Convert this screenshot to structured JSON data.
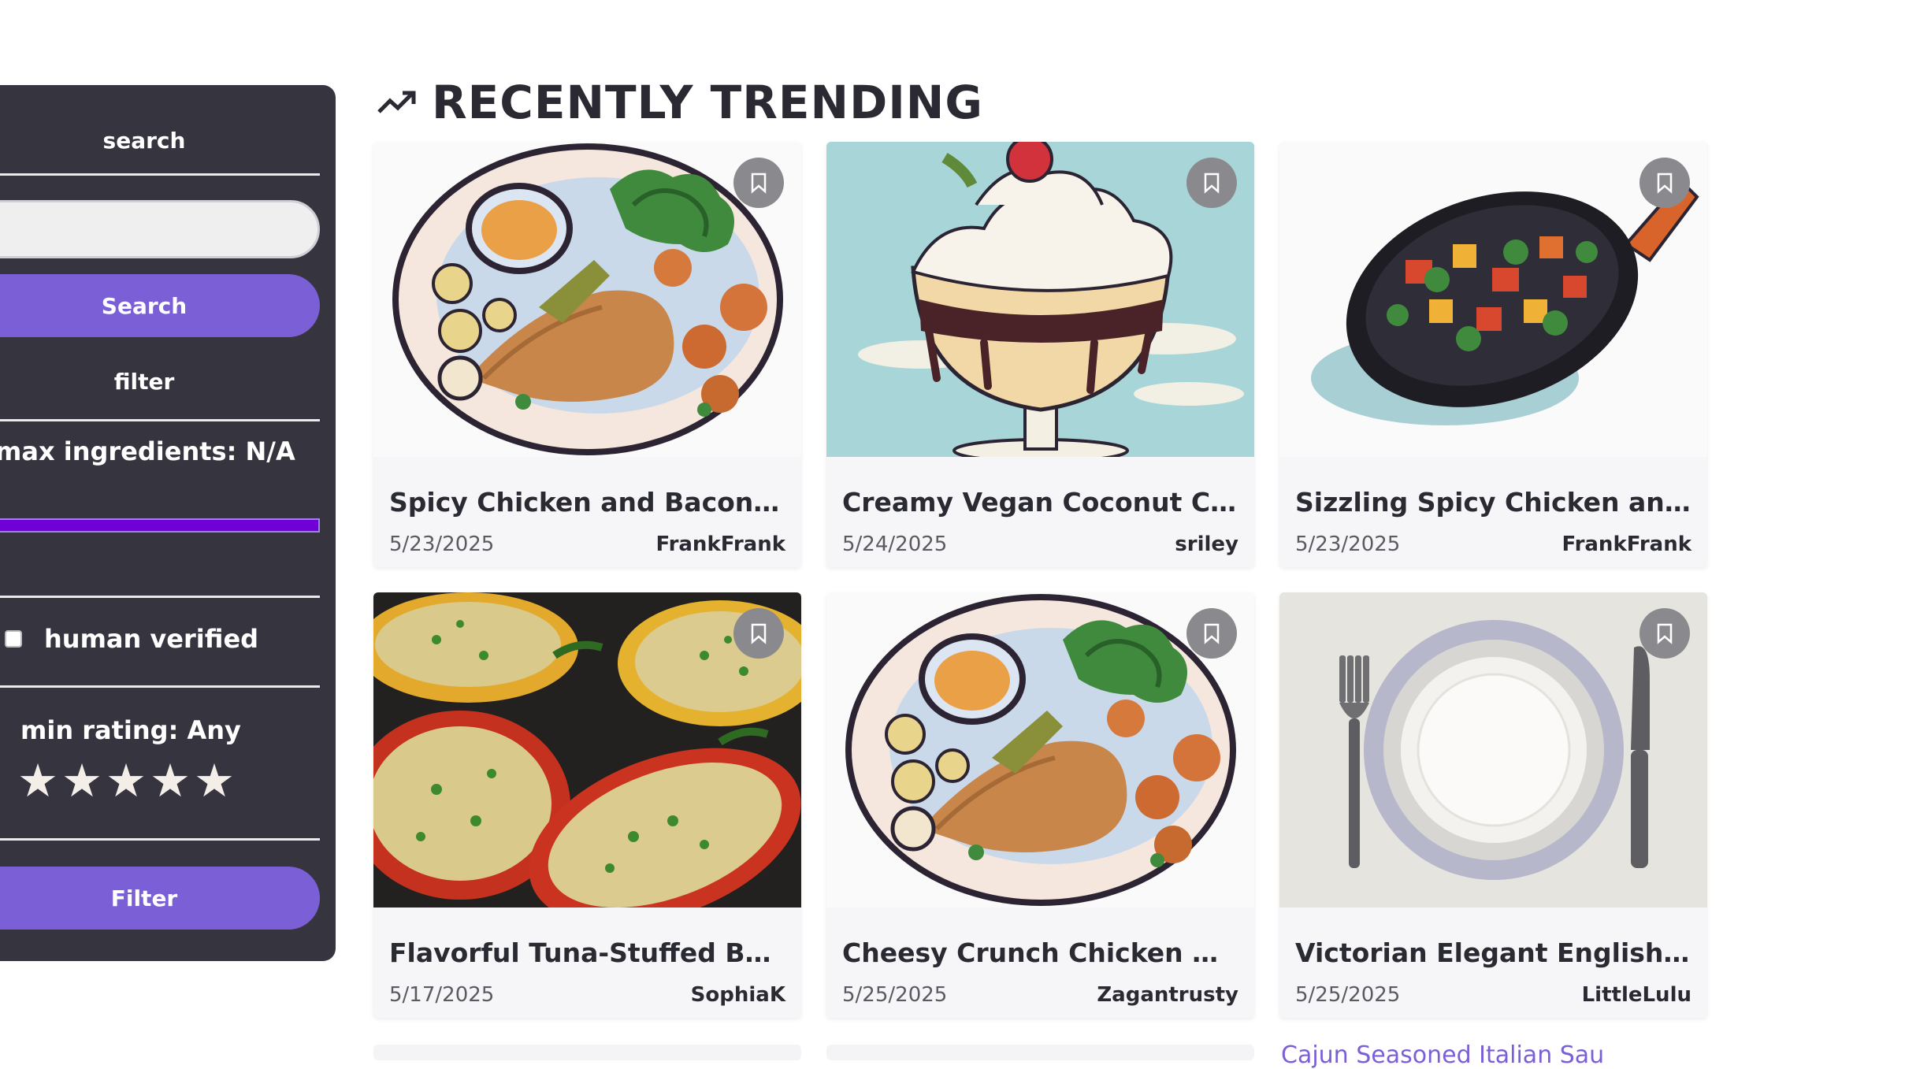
{
  "sidebar": {
    "search_heading": "search",
    "search_input_value": "",
    "search_button": "Search",
    "filter_heading": "filter",
    "max_ingredients_label": "max ingredients: N/A",
    "human_verified_label": "human verified",
    "human_verified_checked": false,
    "min_rating_label": "min rating: Any",
    "stars": [
      "★",
      "★",
      "★",
      "★",
      "★"
    ],
    "filter_button": "Filter"
  },
  "main": {
    "section_title": "RECENTLY TRENDING",
    "recipes": [
      {
        "title": "Spicy Chicken and Bacon Fusi...",
        "date": "5/23/2025",
        "author": "FrankFrank",
        "image": "chicken-plate"
      },
      {
        "title": "Creamy Vegan Coconut Choc...",
        "date": "5/24/2025",
        "author": "sriley",
        "image": "sundae"
      },
      {
        "title": "Sizzling Spicy Chicken and Ba...",
        "date": "5/23/2025",
        "author": "FrankFrank",
        "image": "skillet"
      },
      {
        "title": "Flavorful Tuna-Stuffed Bell Pe...",
        "date": "5/17/2025",
        "author": "SophiaK",
        "image": "stuffed-peppers"
      },
      {
        "title": "Cheesy Crunch Chicken with ...",
        "date": "5/25/2025",
        "author": "Zagantrusty",
        "image": "chicken-plate"
      },
      {
        "title": "Victorian Elegant English She...",
        "date": "5/25/2025",
        "author": "LittleLulu",
        "image": "empty-plate"
      }
    ],
    "partial_link_text": "Cajun Seasoned Italian Sau"
  },
  "colors": {
    "sidebar_bg": "#36343f",
    "accent": "#7b5fd6",
    "slider": "#6f00d6",
    "bookmark_bg": "#8a8a8e"
  }
}
